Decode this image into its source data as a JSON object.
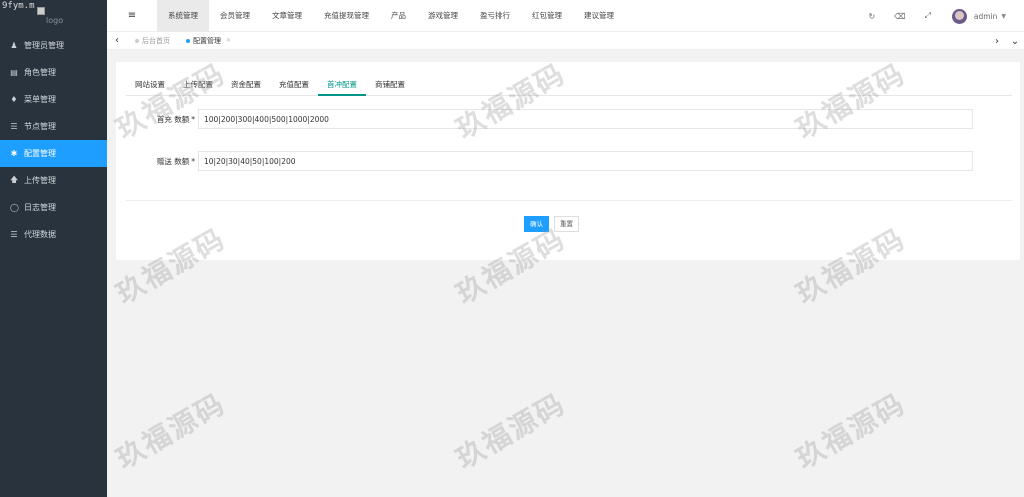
{
  "brand": {
    "watermark_url": "9fym.m",
    "logo_alt": "logo"
  },
  "sidebar": {
    "items": [
      {
        "label": "管理员管理",
        "icon": "user-icon"
      },
      {
        "label": "角色管理",
        "icon": "id-card-icon"
      },
      {
        "label": "菜单管理",
        "icon": "bell-icon"
      },
      {
        "label": "节点管理",
        "icon": "list-icon"
      },
      {
        "label": "配置管理",
        "icon": "gear-icon",
        "active": true
      },
      {
        "label": "上传管理",
        "icon": "upload-icon"
      },
      {
        "label": "日志管理",
        "icon": "globe-icon"
      },
      {
        "label": "代理数据",
        "icon": "list-icon"
      }
    ]
  },
  "header": {
    "tabs": [
      "系统管理",
      "会员管理",
      "文章管理",
      "充值提现管理",
      "产品",
      "游戏管理",
      "盈亏排行",
      "红包管理",
      "建议管理"
    ],
    "active_tab": 0,
    "user": "admin"
  },
  "pagebar": {
    "tabs": [
      "后台首页",
      "配置管理"
    ],
    "active_tab": 1
  },
  "config_tabs": {
    "items": [
      "网站设置",
      "上传配置",
      "资金配置",
      "充值配置",
      "首冲配置",
      "商铺配置"
    ],
    "active": 4
  },
  "form": {
    "field1": {
      "label": "首充 数额",
      "required": "*",
      "value": "100|200|300|400|500|1000|2000"
    },
    "field2": {
      "label": "赠送 数额",
      "required": "*",
      "value": "10|20|30|40|50|100|200"
    },
    "submit_label": "确认",
    "reset_label": "重置"
  },
  "watermark_text": "玖福源码",
  "colors": {
    "sidebar_bg": "#28333e",
    "accent": "#1e9fff",
    "tab_active": "#009688"
  }
}
